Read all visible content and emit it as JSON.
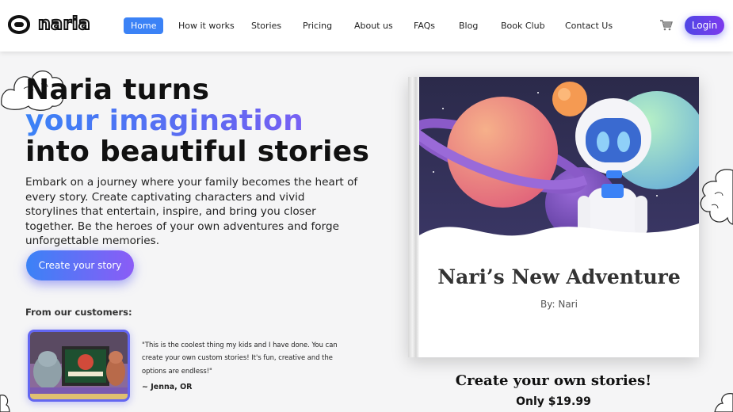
{
  "brand": {
    "logo_text": "naria"
  },
  "nav": {
    "items": [
      {
        "label": "Home",
        "active": true
      },
      {
        "label": "How it works"
      },
      {
        "label": "Stories"
      },
      {
        "label": "Pricing"
      },
      {
        "label": "About us"
      },
      {
        "label": "FAQs"
      },
      {
        "label": "Blog"
      },
      {
        "label": "Book Club"
      },
      {
        "label": "Contact Us"
      }
    ],
    "login_label": "Login",
    "cart_icon": "cart-icon"
  },
  "hero": {
    "line1": "Naria turns",
    "line2": "your imagination",
    "line3": "into beautiful stories",
    "description": "Embark on a journey where your family becomes the heart of every story. Create captivating characters and vivid storylines that entertain, inspire, and bring you closer together. Be the heroes of your own adventures and forge unforgettable memories.",
    "cta_label": "Create your story"
  },
  "customers": {
    "label": "From our customers:",
    "quote": "\"This is the coolest thing my kids and I have done. You can create your own custom stories! It's fun, creative and the options are endless!\"",
    "author": "~ Jenna, OR"
  },
  "book": {
    "title": "Nari’s New Adventure",
    "author": "By: Nari"
  },
  "promo": {
    "title": "Create your own stories!",
    "price": "Only $19.99"
  },
  "colors": {
    "accent_blue": "#3b82f6",
    "accent_purple": "#8b5cf6",
    "login_start": "#4f46e5"
  }
}
